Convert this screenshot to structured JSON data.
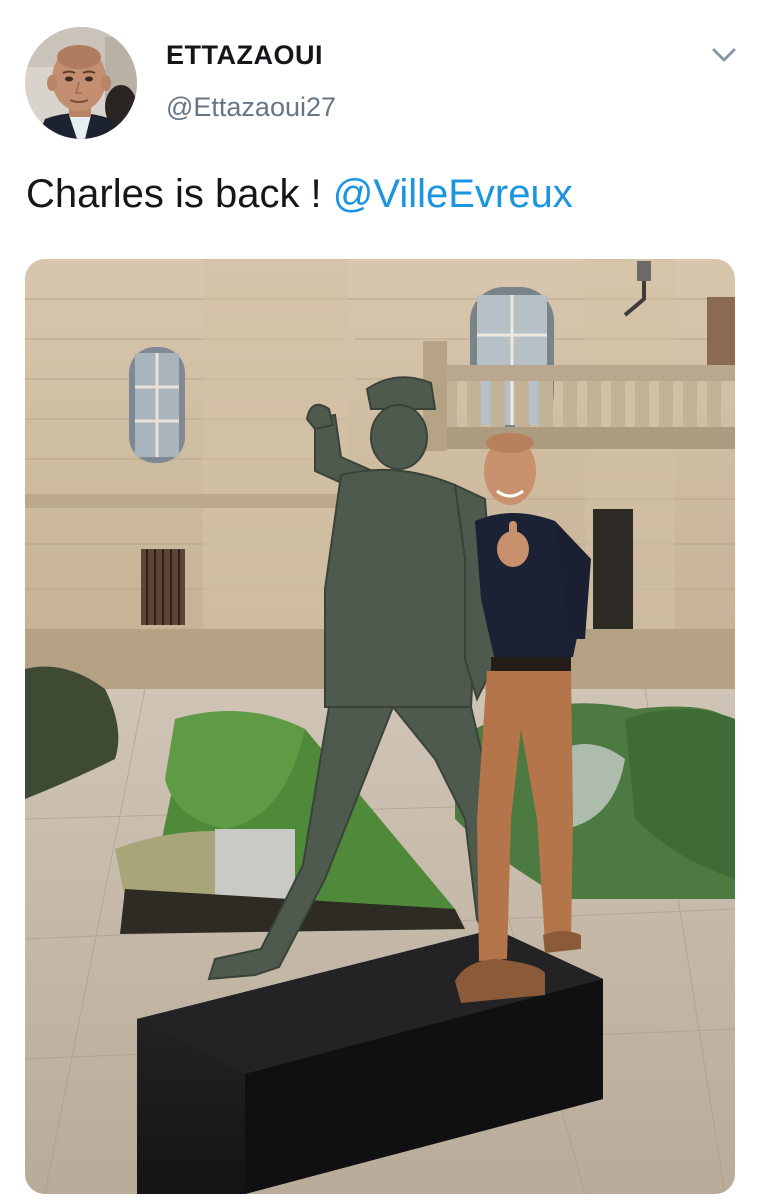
{
  "tweet": {
    "display_name": "ETTAZAOUI",
    "handle": "@Ettazaoui27",
    "text_before_mention": "Charles is back ! ",
    "mention": "@VilleEvreux"
  },
  "colors": {
    "mention": "#1b95e0",
    "handle": "#657786",
    "text": "#14171a"
  },
  "icons": {
    "menu": "chevron-down-icon",
    "avatar": "profile-photo"
  }
}
